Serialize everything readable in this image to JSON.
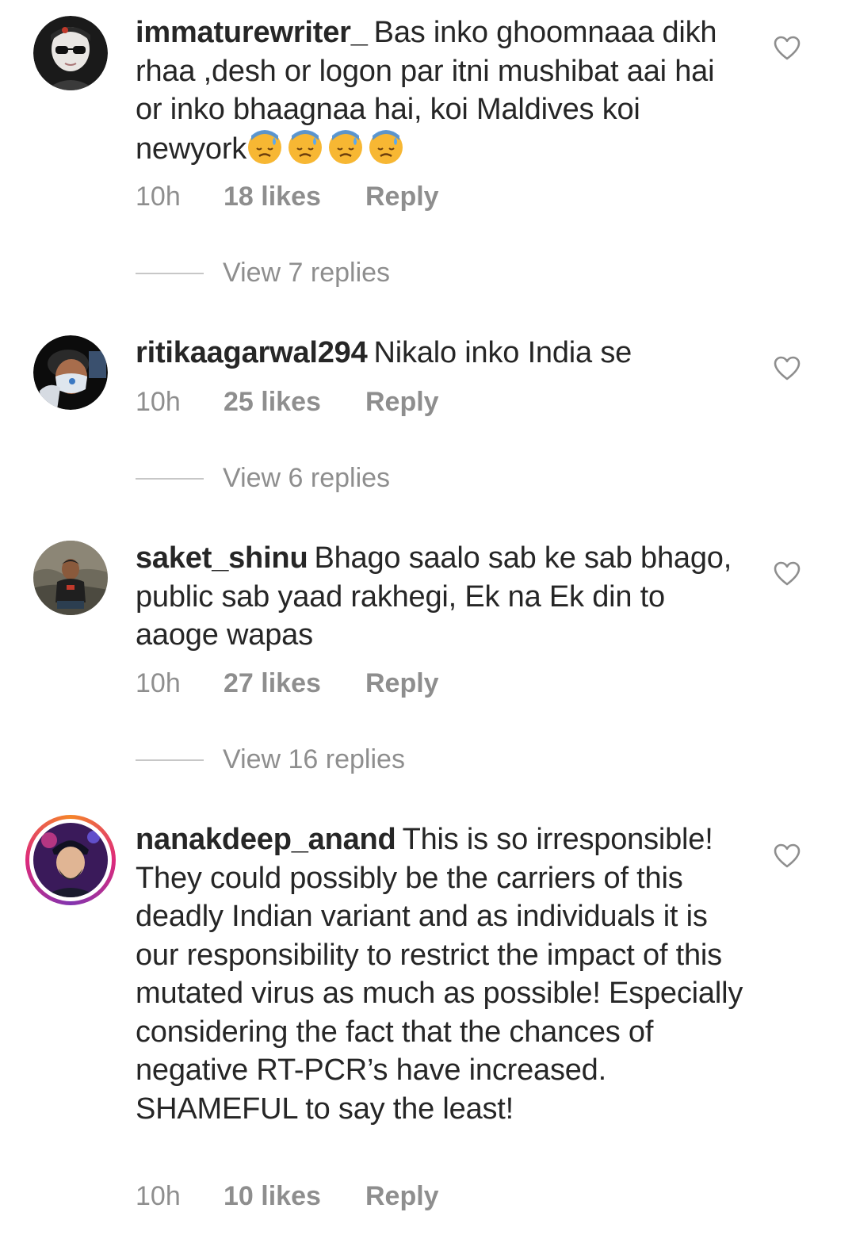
{
  "comments": [
    {
      "username": "immaturewriter_",
      "text": "Bas inko ghoomnaaa dikh rhaa ,desh or logon par itni mushibat aai hai or inko bhaagnaa hai, koi Maldives koi newyork",
      "emoji": [
        "downcast-face-with-sweat",
        "downcast-face-with-sweat",
        "downcast-face-with-sweat",
        "downcast-face-with-sweat"
      ],
      "time": "10h",
      "likes": "18 likes",
      "reply": "Reply",
      "view_replies": "View 7 replies"
    },
    {
      "username": "ritikaagarwal294",
      "text": "Nikalo inko India se",
      "time": "10h",
      "likes": "25 likes",
      "reply": "Reply",
      "view_replies": "View 6 replies"
    },
    {
      "username": "saket_shinu",
      "text": "Bhago saalo sab ke sab bhago, public sab yaad rakhegi, Ek na Ek din to aaoge wapas",
      "time": "10h",
      "likes": "27 likes",
      "reply": "Reply",
      "view_replies": "View 16 replies"
    },
    {
      "username": "nanakdeep_anand",
      "text": "This is so irresponsible! They could possibly be the carriers of this deadly Indian variant and as individuals it is our responsibility to restrict the impact of this mutated virus as much as possible! Especially considering the fact that the chances of negative RT-PCR’s have increased. SHAMEFUL to say the least!",
      "time": "10h",
      "likes": "10 likes",
      "reply": "Reply"
    }
  ],
  "icons": {
    "like": "heart-outline-icon",
    "emoji": "downcast-face-with-sweat"
  },
  "colors": {
    "text": "#262626",
    "meta": "#8e8e8e",
    "divider": "#c7c7c7",
    "story_ring_start": "#f58529",
    "story_ring_end": "#8134af"
  }
}
